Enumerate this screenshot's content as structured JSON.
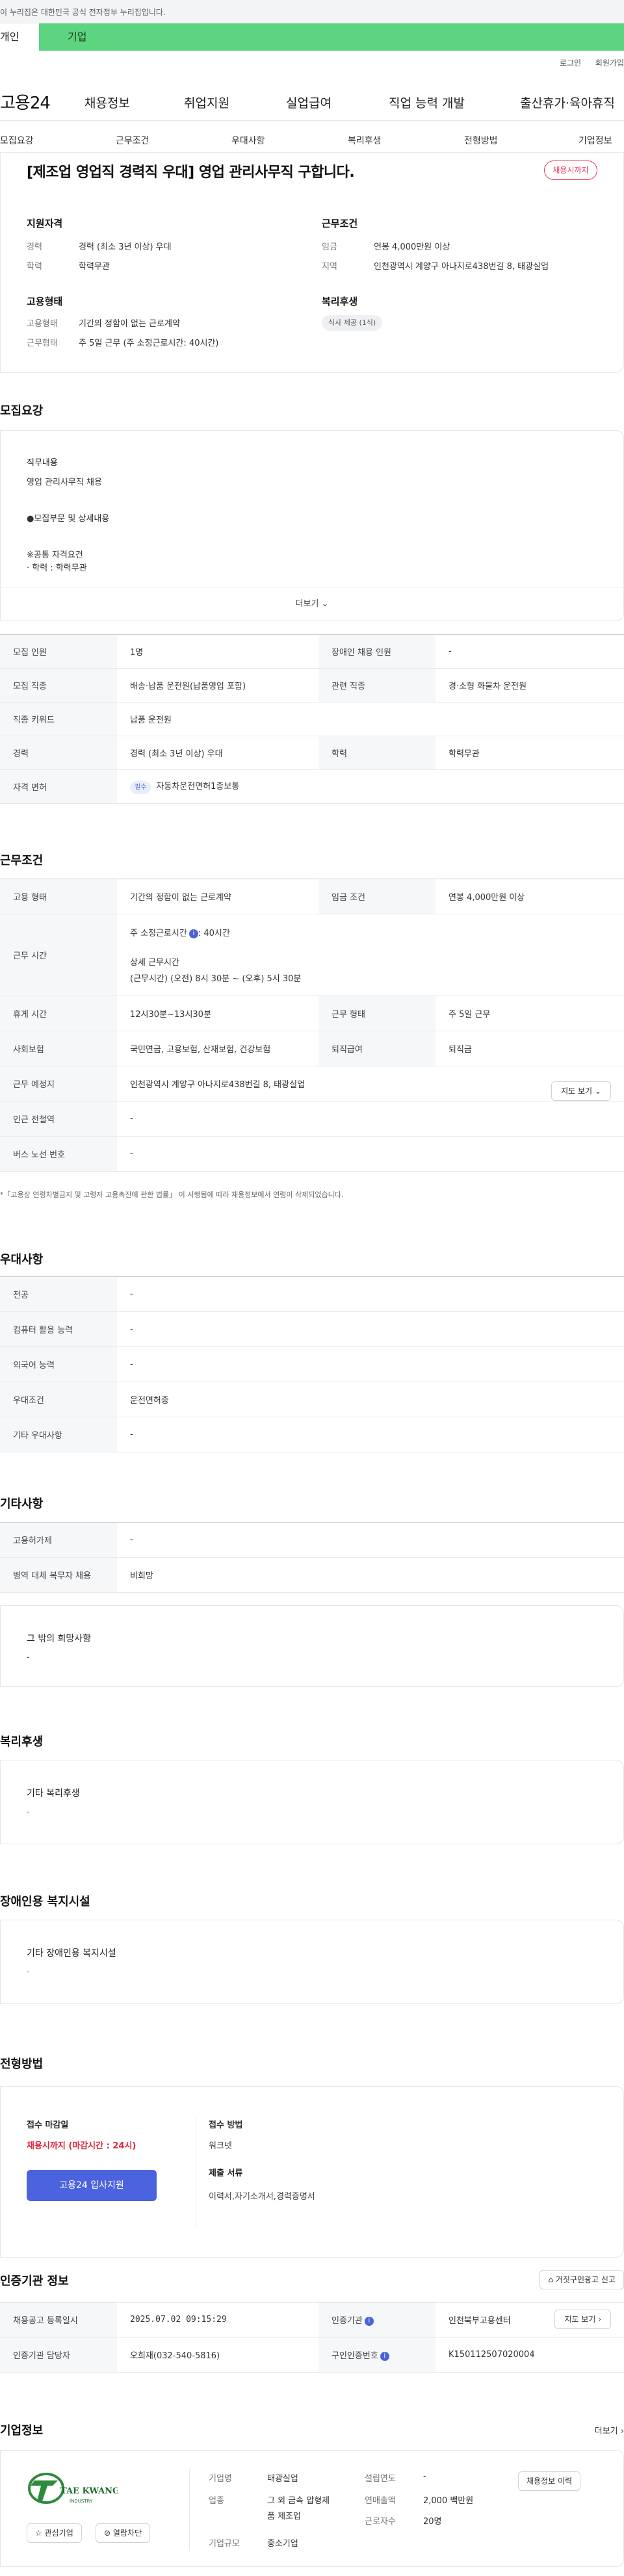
{
  "gov_notice": "이 누리집은 대한민국 공식 전자정부 누리집입니다.",
  "login_tabs": {
    "individual": "개인",
    "company": "기업"
  },
  "util_links": {
    "login": "로그인",
    "signup": "회원가입"
  },
  "gnb": {
    "logo": "고용24",
    "items": [
      "채용정보",
      "취업지원",
      "실업급여",
      "직업 능력 개발",
      "출산휴가·육아휴직"
    ]
  },
  "lnb": {
    "items": [
      "모집요강",
      "근무조건",
      "우대사항",
      "복리후생",
      "전형방법",
      "기업정보"
    ]
  },
  "summary": {
    "title": "[제조업 영업직 경력직 우대] 영업 관리사무직 구합니다.",
    "status": "채용시까지",
    "qual_head": "지원자격",
    "qual": [
      {
        "k": "경력",
        "v": "경력 (최소 3년 이상) 우대"
      },
      {
        "k": "학력",
        "v": "학력무관"
      }
    ],
    "cond_head": "근무조건",
    "cond": [
      {
        "k": "임금",
        "v": "연봉 4,000만원 이상"
      },
      {
        "k": "지역",
        "v": "인천광역시 계양구 아나지로438번길 8, 태광실업"
      }
    ],
    "emp_head": "고용형태",
    "emp": [
      {
        "k": "고용형태",
        "v": "기간의 정함이 없는 근로계약"
      },
      {
        "k": "근무형태",
        "v": "주 5일 근무 (주 소정근로시간: 40시간)"
      }
    ],
    "welfare_head": "복리후생",
    "welfare_chip": "식사 제공 (1식)"
  },
  "recruit": {
    "section_title": "모집요강",
    "desc_label": "직무내용",
    "desc_text": "영업 관리사무직 채용",
    "desc_bullet": "●모집부문 및 상세내용",
    "desc_q1": "※공통 자격요건",
    "desc_q2": "· 학력 : 학력무관",
    "more": "더보기",
    "rows": [
      {
        "k1": "모집 인원",
        "v1": "1명",
        "k2": "장애인 채용 인원",
        "v2": "-"
      },
      {
        "k1": "모집 직종",
        "v1": "배송·납품 운전원(납품영업 포함)",
        "k2": "관련 직종",
        "v2": "경·소형 화물차 운전원"
      },
      {
        "k1": "직종 키워드",
        "v1": "납품 운전원",
        "k2": "",
        "v2": ""
      },
      {
        "k1": "경력",
        "v1": "경력 (최소 3년 이상) 우대",
        "k2": "학력",
        "v2": "학력무관"
      }
    ],
    "license_k": "자격 면허",
    "license_tag": "필수",
    "license_v": "자동차운전면허1종보통"
  },
  "work": {
    "section_title": "근무조건",
    "type_k": "고용 형태",
    "type_v": "기간의 정함이 없는 근로계약",
    "wage_k": "임금 조건",
    "wage_v": "연봉 4,000만원 이상",
    "hours_k": "근무 시간",
    "hours_main": "주 소정근로시간",
    "hours_main_v": ": 40시간",
    "hours_detail_label": "상세 근무시간",
    "hours_detail": "(근무시간) (오전) 8시 30분 ~ (오후) 5시 30분",
    "break_k": "휴게 시간",
    "break_v": "12시30분~13시30분",
    "form_k": "근무 형태",
    "form_v": "주 5일 근무",
    "ins_k": "사회보험",
    "ins_v": "국민연금, 고용보험, 산재보험, 건강보험",
    "retire_k": "퇴직급여",
    "retire_v": "퇴직금",
    "place_k": "근무 예정지",
    "place_v": "인천광역시 계양구 아나지로438번길 8, 태광실업",
    "map_btn": "지도 보기",
    "subway_k": "인근 전철역",
    "subway_v": "-",
    "bus_k": "버스 노선 번호",
    "bus_v": "-",
    "note": "*「고용상 연령차별금지 및 고령자 고용촉진에 관한 법률」 이 시행됨에 따라 채용정보에서 연령이 삭제되었습니다."
  },
  "preference": {
    "section_title": "우대사항",
    "rows": [
      {
        "k": "전공",
        "v": "-"
      },
      {
        "k": "컴퓨터 활용 능력",
        "v": "-"
      },
      {
        "k": "외국어 능력",
        "v": "-"
      },
      {
        "k": "우대조건",
        "v": "운전면허증"
      },
      {
        "k": "기타 우대사항",
        "v": "-"
      }
    ]
  },
  "etc": {
    "section_title": "기타사항",
    "rows": [
      {
        "k": "고용허가제",
        "v": "-"
      },
      {
        "k": "병역 대체 복무자 채용",
        "v": "비희망"
      }
    ],
    "wish_h": "그 밖의 희망사항",
    "wish_v": "-"
  },
  "welfare": {
    "section_title": "복리후생",
    "h": "기타 복리후생",
    "v": "-"
  },
  "disabled": {
    "section_title": "장애인용 복지시설",
    "h": "기타 장애인용 복지시설",
    "v": "-"
  },
  "screening": {
    "section_title": "전형방법",
    "deadline_h": "접수 마감일",
    "deadline_v": "채용시까지 (마감시간 : 24시)",
    "apply_btn": "고용24 입사지원",
    "method_h": "접수 방법",
    "method_v": "워크넷",
    "docs_h": "제출 서류",
    "docs_v": "이력서,자기소개서,경력증명서"
  },
  "agency": {
    "section_title": "인증기관 정보",
    "report_btn": "거짓구인광고 신고",
    "reg_k": "채용공고 등록일시",
    "reg_v": "2025.07.02 09:15:29",
    "org_k": "인증기관",
    "org_v": "인천북부고용센터",
    "map_btn": "지도 보기",
    "staff_k": "인증기관 담당자",
    "staff_v": "오희재(032-540-5816)",
    "id_k": "구인인증번호",
    "id_v": "K150112507020004"
  },
  "company": {
    "section_title": "기업정보",
    "more": "더보기",
    "logo_text": "TAE KWANG",
    "logo_sub": "INDUSTRY",
    "fav_btn": "관심기업",
    "block_btn": "열람차단",
    "name_k": "기업명",
    "name_v": "태광실업",
    "biz_k": "업종",
    "biz_v1": "그 외 금속 압형제",
    "biz_v2": "품 제조업",
    "scale_k": "기업규모",
    "scale_v": "중소기업",
    "founded_k": "설립연도",
    "founded_v": "-",
    "sales_k": "연매출액",
    "sales_v": "2,000 백만원",
    "emp_k": "근로자수",
    "emp_v": "20명",
    "history_btn": "채용정보 이력"
  }
}
